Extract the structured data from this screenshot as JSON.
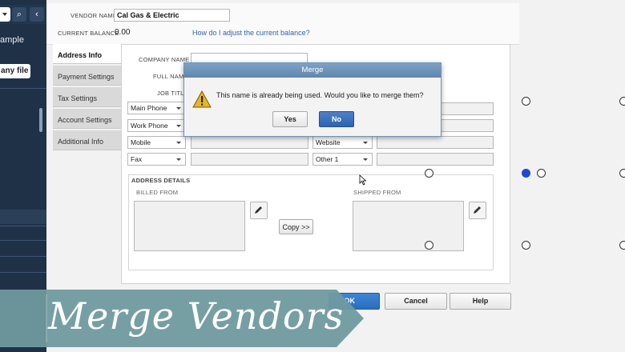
{
  "left_nav": {
    "company_label": "ample",
    "file_button": "any file"
  },
  "vendor": {
    "name_label": "VENDOR NAME",
    "name_value": "Cal Gas & Electric",
    "balance_label": "CURRENT BALANCE",
    "balance_value": "0.00",
    "adjust_link": "How do I adjust the current balance?"
  },
  "tabs": [
    {
      "label": "Address Info",
      "active": true
    },
    {
      "label": "Payment Settings",
      "active": false
    },
    {
      "label": "Tax Settings",
      "active": false
    },
    {
      "label": "Account Settings",
      "active": false
    },
    {
      "label": "Additional Info",
      "active": false
    }
  ],
  "fields": {
    "company_name": "COMPANY NAME",
    "full_name": "FULL NAME",
    "job_title": "JOB TITLE"
  },
  "phone_selects": [
    "Main Phone",
    "Work Phone",
    "Mobile",
    "Fax"
  ],
  "right_selects": {
    "website": "Website",
    "other": "Other 1"
  },
  "address": {
    "title": "ADDRESS DETAILS",
    "billed_from": "BILLED FROM",
    "shipped_from": "SHIPPED FROM",
    "copy_button": "Copy >>"
  },
  "dialog": {
    "title": "Merge",
    "message": "This name is already being used. Would you like to merge them?",
    "yes": "Yes",
    "no": "No",
    "icon": "warning-icon"
  },
  "bottom_buttons": {
    "ok": "OK",
    "cancel": "Cancel",
    "help": "Help"
  },
  "banner": {
    "text": "Merge Vendors",
    "color": "#6f9a9f"
  },
  "colors": {
    "nav_bg": "#1f3147",
    "accent": "#2e63b0",
    "radio_selected": "#1f48d8"
  }
}
